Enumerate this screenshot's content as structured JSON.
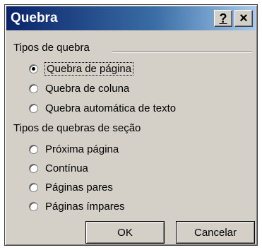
{
  "window": {
    "title": "Quebra",
    "help_glyph": "?",
    "close_glyph": "×"
  },
  "group1": {
    "label": "Tipos de quebra",
    "options": [
      {
        "label": "Quebra de página",
        "checked": true
      },
      {
        "label": "Quebra de coluna",
        "checked": false
      },
      {
        "label": "Quebra automática de texto",
        "checked": false
      }
    ]
  },
  "group2": {
    "label": "Tipos de quebras de seção",
    "options": [
      {
        "label": "Próxima página",
        "checked": false
      },
      {
        "label": "Contínua",
        "checked": false
      },
      {
        "label": "Páginas pares",
        "checked": false
      },
      {
        "label": "Páginas ímpares",
        "checked": false
      }
    ]
  },
  "buttons": {
    "ok": "OK",
    "cancel": "Cancelar"
  }
}
